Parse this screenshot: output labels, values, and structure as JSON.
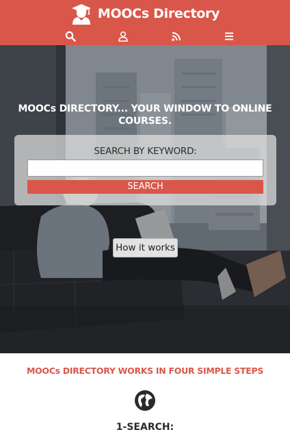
{
  "header": {
    "brand": "MOOCs Directory",
    "logo_icon": "graduate-icon",
    "background": "#d9574a",
    "nav": [
      {
        "name": "search",
        "icon": "search-icon"
      },
      {
        "name": "account",
        "icon": "user-icon"
      },
      {
        "name": "feed",
        "icon": "rss-icon"
      },
      {
        "name": "menu",
        "icon": "menu-icon"
      }
    ]
  },
  "hero": {
    "title": "MOOCs DIRECTORY... YOUR WINDOW TO ONLINE COURSES.",
    "search": {
      "label": "SEARCH BY KEYWORD:",
      "value": "",
      "button": "SEARCH"
    },
    "how_button": "How it works"
  },
  "steps": {
    "title": "MOOCs DIRECTORY WORKS IN FOUR SIMPLE STEPS",
    "items": [
      {
        "icon": "globe-icon",
        "title": "1-SEARCH:"
      }
    ]
  },
  "colors": {
    "accent": "#d9574a",
    "panel": "#e1e1e1"
  }
}
